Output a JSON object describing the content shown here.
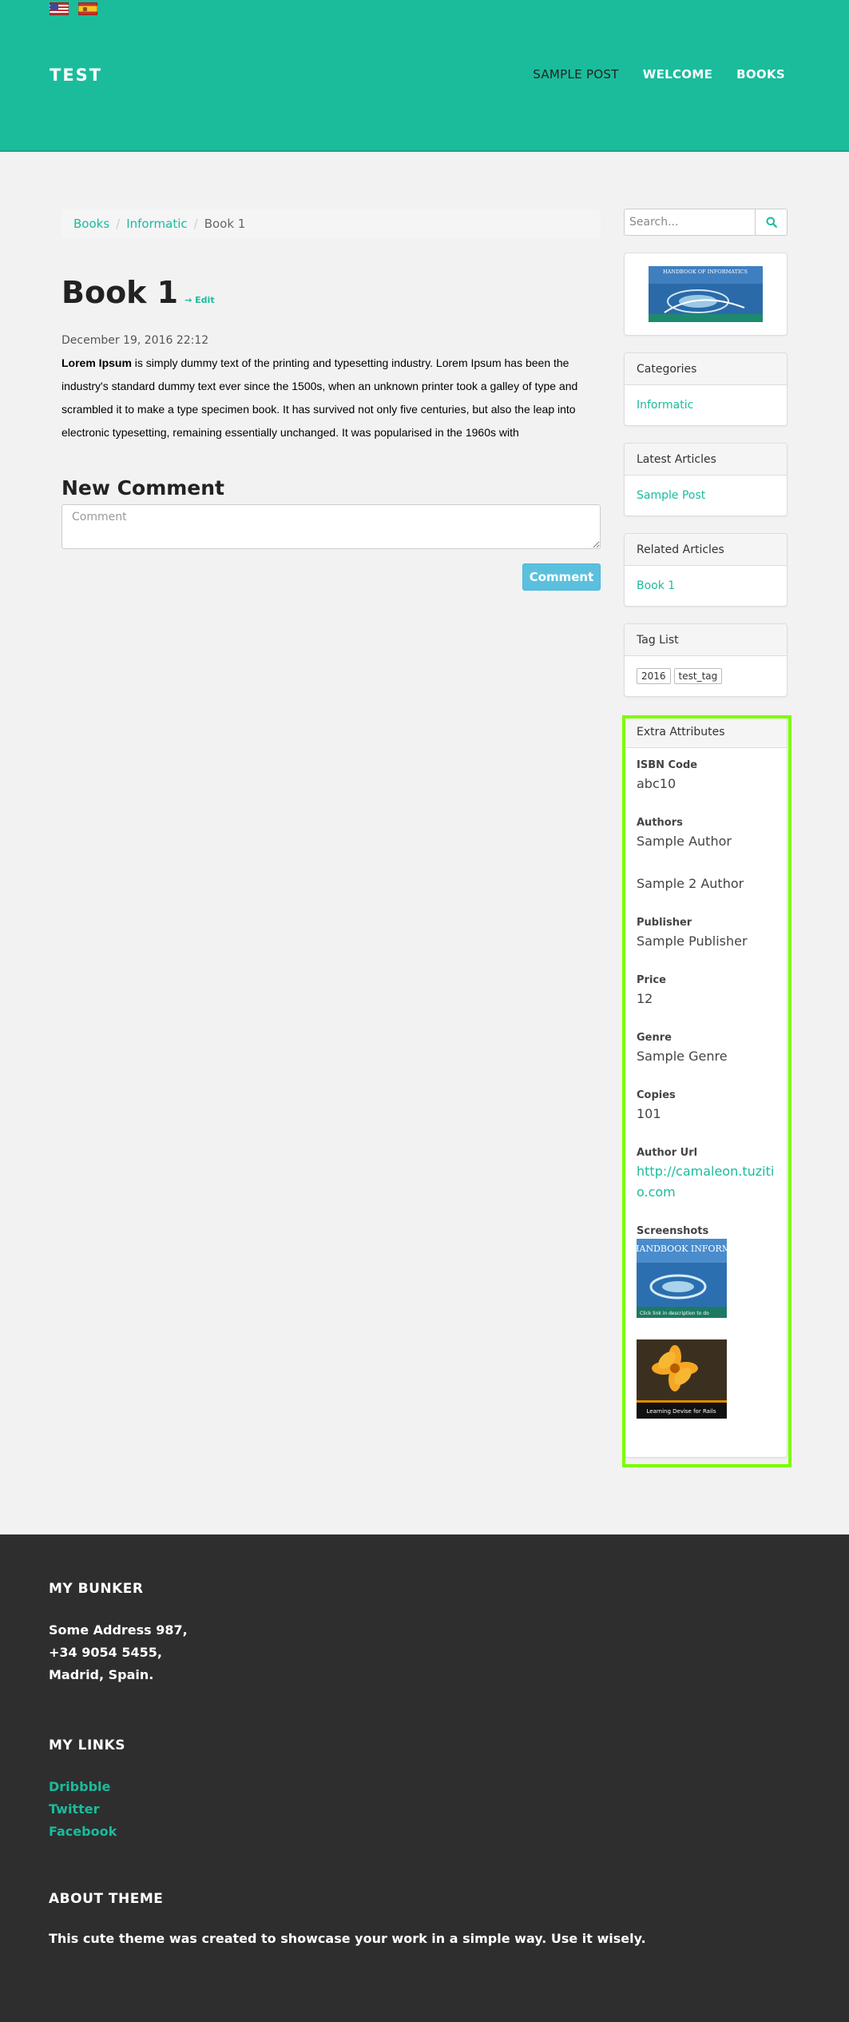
{
  "header": {
    "languages": [
      {
        "code": "en",
        "icon": "us-flag-icon"
      },
      {
        "code": "es",
        "icon": "es-flag-icon"
      }
    ],
    "brand": "TEST",
    "nav": [
      {
        "label": "SAMPLE POST",
        "active": true
      },
      {
        "label": "WELCOME",
        "active": false
      },
      {
        "label": "BOOKS",
        "active": false
      }
    ]
  },
  "breadcrumb": {
    "items": [
      "Books",
      "Informatic"
    ],
    "current": "Book 1"
  },
  "post": {
    "title": "Book 1",
    "edit_label": "→ Edit",
    "date": "December 19, 2016 22:12",
    "body_bold": "Lorem Ipsum",
    "body_text": " is simply dummy text of the printing and typesetting industry. Lorem Ipsum has been the industry's standard dummy text ever since the 1500s, when an unknown printer took a galley of type and scrambled it to make a type specimen book. It has survived not only five centuries, but also the leap into electronic typesetting, remaining essentially unchanged. It was popularised in the 1960s with"
  },
  "comment": {
    "title": "New Comment",
    "placeholder": "Comment",
    "button": "Comment"
  },
  "sidebar": {
    "search_placeholder": "Search...",
    "search_icon": "search-icon",
    "cover_text": "HANDBOOK OF INFORMATICS",
    "categories": {
      "title": "Categories",
      "items": [
        "Informatic"
      ]
    },
    "latest": {
      "title": "Latest Articles",
      "items": [
        "Sample Post"
      ]
    },
    "related": {
      "title": "Related Articles",
      "items": [
        "Book 1"
      ]
    },
    "tags": {
      "title": "Tag List",
      "items": [
        "2016",
        "test_tag"
      ]
    },
    "extra": {
      "title": "Extra Attributes",
      "isbn_label": "ISBN Code",
      "isbn": "abc10",
      "authors_label": "Authors",
      "author_1": "Sample Author",
      "author_2": "Sample 2 Author",
      "publisher_label": "Publisher",
      "publisher": "Sample Publisher",
      "price_label": "Price",
      "price": "12",
      "genre_label": "Genre",
      "genre": "Sample Genre",
      "copies_label": "Copies",
      "copies": "101",
      "url_label": "Author Url",
      "url": "http://camaleon.tuzitio.com",
      "screenshots_label": "Screenshots",
      "shot_1_text": "HANDBOOK INFORM",
      "shot_1_caption": "Click link in description to do",
      "shot_2_caption": "Learning Devise for Rails"
    }
  },
  "footer": {
    "bunker_title": "MY BUNKER",
    "address": [
      "Some Address 987,",
      "+34 9054 5455,",
      "Madrid, Spain."
    ],
    "links_title": "MY LINKS",
    "links": [
      "Dribbble",
      "Twitter",
      "Facebook"
    ],
    "about_title": "ABOUT THEME",
    "about_text": "This cute theme was created to showcase your work in a simple way. Use it wisely."
  },
  "colors": {
    "accent": "#1abc9c",
    "footer": "#2e2e2e",
    "highlight": "#7cfc00",
    "button": "#5bc0de"
  }
}
